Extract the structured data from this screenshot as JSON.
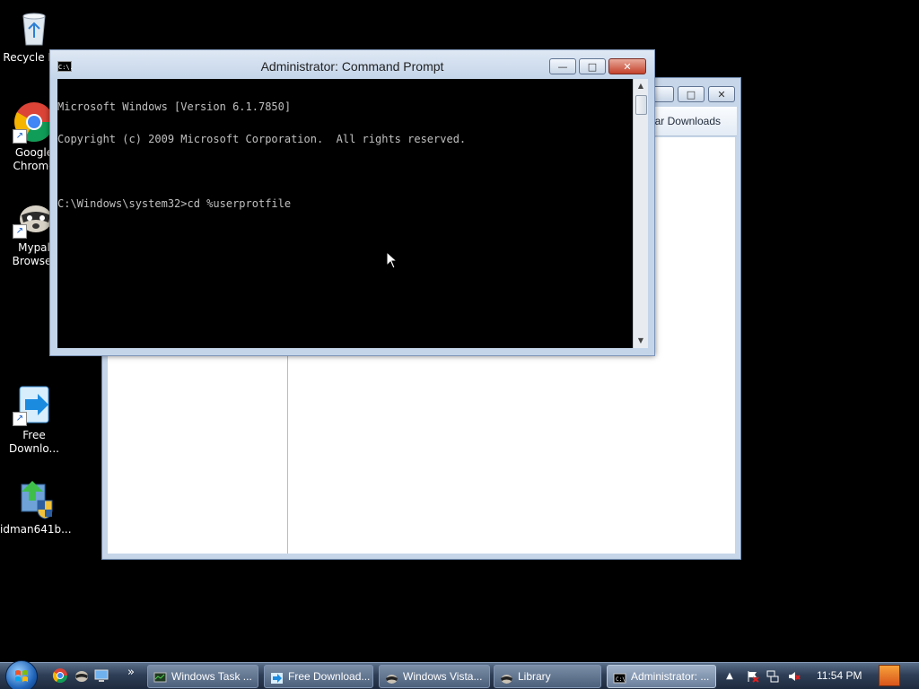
{
  "desktop": {
    "icons": [
      {
        "label": "Recycle Bin",
        "icon": "recycle-bin-icon"
      },
      {
        "label": "Google Chrome",
        "icon": "chrome-icon"
      },
      {
        "label": "Mypal Browser",
        "icon": "mypal-raccoon-icon"
      },
      {
        "label": "Free Downlo...",
        "icon": "free-download-manager-icon"
      },
      {
        "label": "idman641b...",
        "icon": "idm-installer-icon"
      }
    ]
  },
  "background_window": {
    "toolbar_label": "Clear Downloads"
  },
  "cmd_window": {
    "title": "Administrator: Command Prompt",
    "title_icon_text": "C:\\.",
    "lines": [
      "Microsoft Windows [Version 6.1.7850]",
      "Copyright (c) 2009 Microsoft Corporation.  All rights reserved.",
      "",
      "C:\\Windows\\system32>cd %userprotfile"
    ],
    "controls": {
      "minimize": "—",
      "maximize": "□",
      "close": "✕"
    }
  },
  "taskbar": {
    "quick_launch": [
      "chrome-icon",
      "mypal-raccoon-icon",
      "show-desktop-icon"
    ],
    "overflow": "»",
    "tasks": [
      {
        "label": "Windows Task ...",
        "icon": "task-manager-icon",
        "active": false
      },
      {
        "label": "Free Download...",
        "icon": "free-download-manager-icon",
        "active": false
      },
      {
        "label": "Windows Vista...",
        "icon": "mypal-raccoon-icon",
        "active": false
      },
      {
        "label": "Library",
        "icon": "mypal-raccoon-icon",
        "active": false
      },
      {
        "label": "Administrator: ...",
        "icon": "cmd-icon",
        "active": true
      }
    ],
    "tray": {
      "chevron": "▲",
      "icons": [
        "flag-icon",
        "network-icon",
        "volume-muted-icon"
      ],
      "clock": "11:54 PM"
    }
  },
  "colors": {
    "desktop_bg": "#000000",
    "console_bg": "#000000",
    "console_fg": "#c0c0c0",
    "close_red": "#c4422c",
    "taskbar": "#2f3f57"
  }
}
